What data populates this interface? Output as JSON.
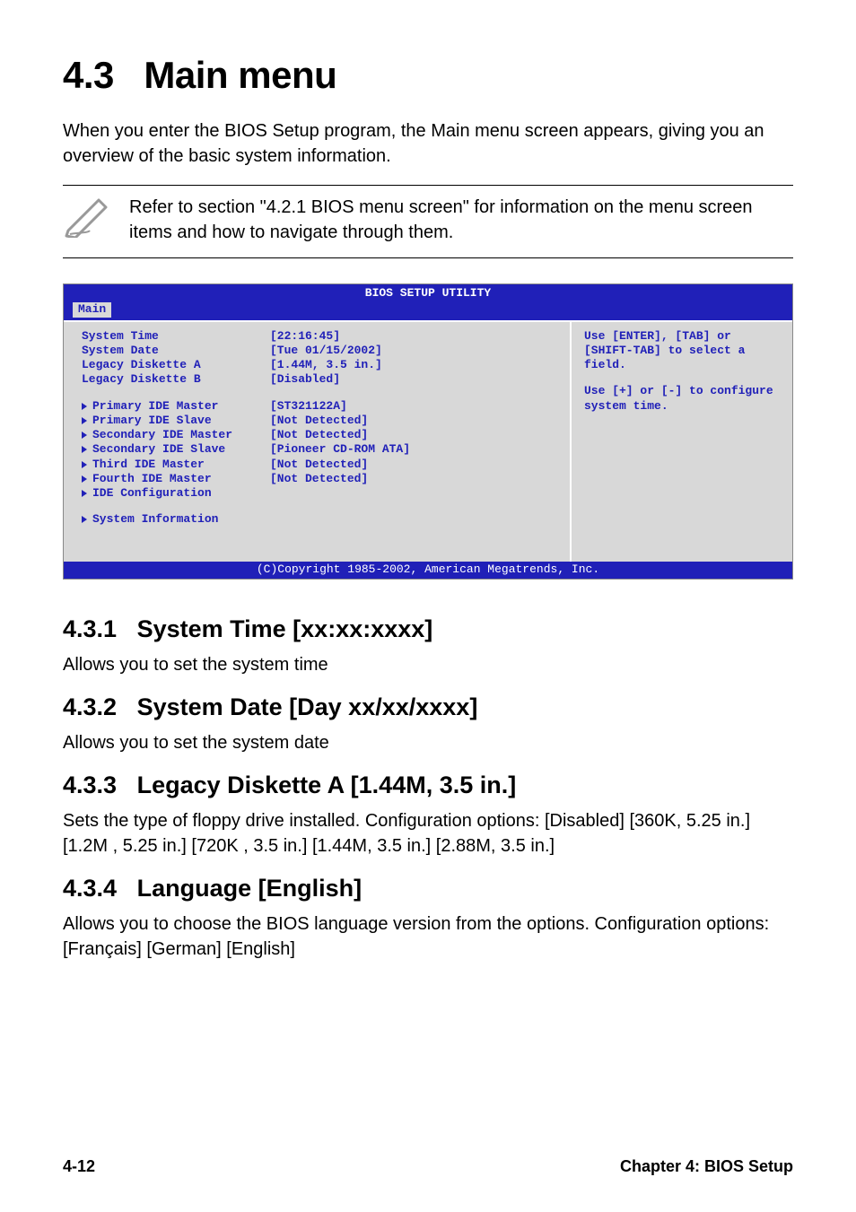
{
  "heading": {
    "number": "4.3",
    "title": "Main menu"
  },
  "intro": "When you enter the BIOS Setup program, the Main menu screen appears, giving you an overview of the basic system information.",
  "note": "Refer to section \"4.2.1  BIOS menu screen\" for information on the menu screen items and how to navigate through them.",
  "bios": {
    "title": "BIOS SETUP UTILITY",
    "tab": "Main",
    "rows_plain": [
      {
        "label": "System Time",
        "value": "[22:16:45]"
      },
      {
        "label": "System Date",
        "value": "[Tue 01/15/2002]"
      },
      {
        "label": "Legacy Diskette A",
        "value": "[1.44M, 3.5 in.]"
      },
      {
        "label": "Legacy Diskette B",
        "value": "[Disabled]"
      }
    ],
    "rows_sub": [
      {
        "label": "Primary IDE Master",
        "value": "[ST321122A]"
      },
      {
        "label": "Primary IDE Slave",
        "value": "[Not Detected]"
      },
      {
        "label": "Secondary IDE Master",
        "value": "[Not Detected]"
      },
      {
        "label": "Secondary IDE Slave",
        "value": "[Pioneer CD-ROM ATA]"
      },
      {
        "label": "Third IDE Master",
        "value": "[Not Detected]"
      },
      {
        "label": "Fourth IDE Master",
        "value": "[Not Detected]"
      },
      {
        "label": "IDE Configuration",
        "value": ""
      }
    ],
    "rows_sub2": [
      {
        "label": "System Information",
        "value": ""
      }
    ],
    "help1": "Use [ENTER], [TAB] or [SHIFT-TAB] to select a field.",
    "help2": "Use [+] or [-] to configure system time.",
    "copyright": "(C)Copyright 1985-2002, American Megatrends, Inc."
  },
  "sections": [
    {
      "num": "4.3.1",
      "title": "System Time [xx:xx:xxxx]",
      "body": "Allows you to set the system time"
    },
    {
      "num": "4.3.2",
      "title": "System Date [Day xx/xx/xxxx]",
      "body": "Allows you to set the system date"
    },
    {
      "num": "4.3.3",
      "title": "Legacy Diskette A [1.44M, 3.5 in.]",
      "body": "Sets the type of floppy drive installed. Configuration options: [Disabled] [360K, 5.25 in.] [1.2M , 5.25 in.] [720K , 3.5 in.] [1.44M, 3.5 in.] [2.88M, 3.5 in.]"
    },
    {
      "num": "4.3.4",
      "title": "Language [English]",
      "body": "Allows you to choose the BIOS language version from the options. Configuration options: [Français] [German] [English]"
    }
  ],
  "footer": {
    "left": "4-12",
    "right": "Chapter 4: BIOS Setup"
  }
}
